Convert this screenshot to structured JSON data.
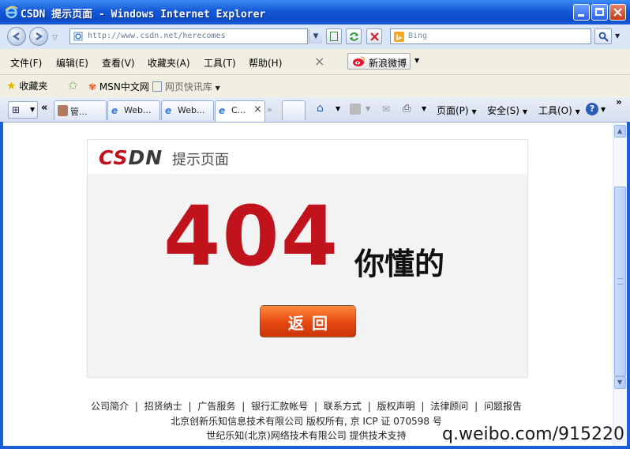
{
  "window": {
    "title": "CSDN 提示页面 - Windows Internet Explorer"
  },
  "address": {
    "url": "http://www.csdn.net/herecomes",
    "search_placeholder": "Bing"
  },
  "menu": {
    "items": [
      "文件(F)",
      "编辑(E)",
      "查看(V)",
      "收藏夹(A)",
      "工具(T)",
      "帮助(H)"
    ],
    "close_glyph": "×",
    "weibo_label": "新浪微博"
  },
  "favorites": {
    "label": "收藏夹",
    "links": [
      "MSN中文网",
      "网页快讯库"
    ]
  },
  "tabs": {
    "items": [
      "管...",
      "Web...",
      "Web...",
      "C..."
    ],
    "nav_back": "«",
    "nav_more": "»",
    "close_glyph": "×"
  },
  "toolbar": {
    "page_label": "页面(P)",
    "safety_label": "安全(S)",
    "tools_label": "工具(O)",
    "more": "»"
  },
  "page": {
    "logo_cs": "CS",
    "logo_dn": "DN",
    "logo_sub": "提示页面",
    "error_code": "404",
    "error_text": "你懂的",
    "back_label": "返回"
  },
  "footer": {
    "links": [
      "公司简介",
      "招贤纳士",
      "广告服务",
      "银行汇款帐号",
      "联系方式",
      "版权声明",
      "法律顾问",
      "问题报告"
    ],
    "separator": "|",
    "company": "北京创新乐知信息技术有限公司 版权所有, 京 ICP 证 070598 号",
    "support": "世纪乐知(北京)网络技术有限公司 提供技术支持"
  },
  "watermark": "q.weibo.com/915220",
  "colors": {
    "brand_red": "#c0131c",
    "button_orange": "#e5470e",
    "titlebar_blue": "#1458d6"
  }
}
